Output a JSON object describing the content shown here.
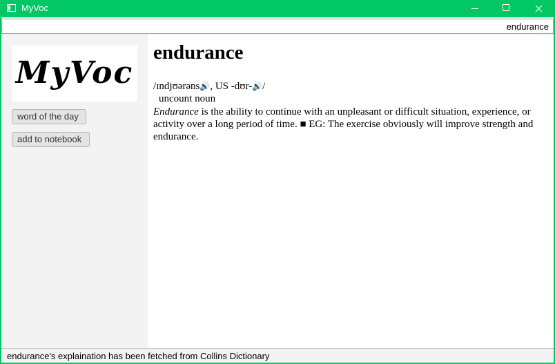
{
  "window": {
    "title": "MyVoc",
    "accent_color": "#02c765"
  },
  "search": {
    "value": "endurance"
  },
  "sidebar": {
    "logo_text": "MyVoc",
    "word_of_the_day_label": "word of the day",
    "add_to_notebook_label": "add to notebook"
  },
  "entry": {
    "headword": "endurance",
    "pron_uk": "/ɪndjʊərəns",
    "pron_sep": ", US -dʊr-",
    "pron_end": "/",
    "speaker_icon": "speaker-icon",
    "part_of_speech": "uncount noun",
    "def_term": "Endurance",
    "def_text": " is the ability to continue with an unpleasant or difficult situation, experience, or activity over a long period of time. ■ EG: The exercise obviously will improve strength and endurance."
  },
  "status": {
    "text": "endurance's explaination has been fetched from Collins Dictionary"
  }
}
